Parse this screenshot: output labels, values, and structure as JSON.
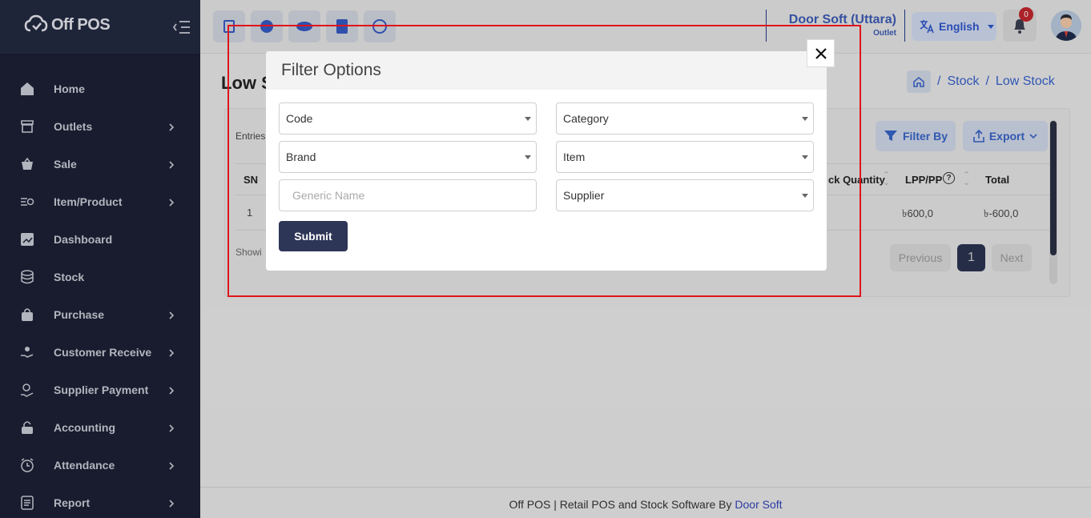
{
  "app": {
    "logo_text": "Off POS"
  },
  "sidebar": {
    "items": [
      {
        "label": "Home",
        "icon": "home-icon",
        "chevron": false
      },
      {
        "label": "Outlets",
        "icon": "store-icon",
        "chevron": true
      },
      {
        "label": "Sale",
        "icon": "basket-icon",
        "chevron": true
      },
      {
        "label": "Item/Product",
        "icon": "tag-icon",
        "chevron": true
      },
      {
        "label": "Dashboard",
        "icon": "chart-icon",
        "chevron": false
      },
      {
        "label": "Stock",
        "icon": "database-icon",
        "chevron": false
      },
      {
        "label": "Purchase",
        "icon": "bag-icon",
        "chevron": true
      },
      {
        "label": "Customer Receive",
        "icon": "hand-coin-icon",
        "chevron": true
      },
      {
        "label": "Supplier Payment",
        "icon": "payment-icon",
        "chevron": true
      },
      {
        "label": "Accounting",
        "icon": "lock-icon",
        "chevron": true
      },
      {
        "label": "Attendance",
        "icon": "clock-icon",
        "chevron": true
      },
      {
        "label": "Report",
        "icon": "report-icon",
        "chevron": true
      }
    ]
  },
  "header": {
    "outlet_name": "Door Soft (Uttara)",
    "outlet_type": "Outlet",
    "language": "English",
    "notification_count": "0"
  },
  "page": {
    "title": "Low S",
    "breadcrumb": [
      "Stock",
      "Low Stock"
    ],
    "entries_label": "Entries",
    "filter_label": "Filter By",
    "export_label": "Export",
    "columns": [
      "SN",
      "ck Quantity",
      "LPP/PP",
      "Total"
    ],
    "rows": [
      {
        "sn": "1",
        "lpp": "৳600,0",
        "total": "৳-600,0"
      }
    ],
    "showing": "Showi",
    "pagination": {
      "prev": "Previous",
      "current": "1",
      "next": "Next"
    }
  },
  "footer": {
    "text": "Off POS | Retail POS and Stock Software By ",
    "link": "Door Soft"
  },
  "modal": {
    "title": "Filter Options",
    "fields": {
      "code": "Code",
      "category": "Category",
      "brand": "Brand",
      "item": "Item",
      "generic_placeholder": "Generic Name",
      "supplier": "Supplier"
    },
    "submit": "Submit"
  }
}
